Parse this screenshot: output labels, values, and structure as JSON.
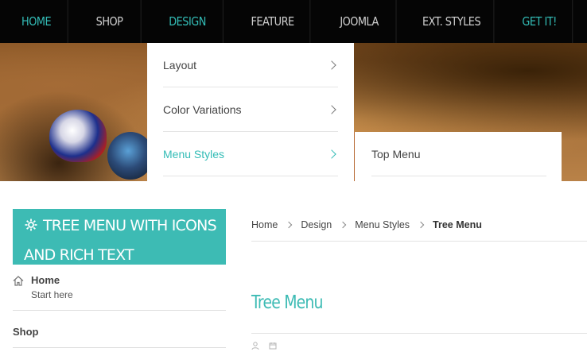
{
  "topnav": {
    "items": [
      {
        "label": "HOME"
      },
      {
        "label": "SHOP"
      },
      {
        "label": "DESIGN"
      },
      {
        "label": "FEATURE"
      },
      {
        "label": "JOOMLA"
      },
      {
        "label": "EXT. STYLES"
      },
      {
        "label": "GET IT!"
      }
    ]
  },
  "dropdown": {
    "items": [
      {
        "label": "Layout"
      },
      {
        "label": "Color Variations"
      },
      {
        "label": "Menu Styles"
      }
    ],
    "submenu": {
      "items": [
        {
          "label": "Top Menu"
        }
      ]
    }
  },
  "sidebar": {
    "module_title": "TREE MENU WITH ICONS AND RICH TEXT",
    "items": [
      {
        "label": "Home",
        "sublabel": "Start here",
        "icon": "home-icon"
      },
      {
        "label": "Shop"
      }
    ]
  },
  "breadcrumb": {
    "items": [
      "Home",
      "Design",
      "Menu Styles"
    ],
    "current": "Tree Menu"
  },
  "article": {
    "title": "Tree Menu"
  },
  "colors": {
    "accent": "#3dbbb4",
    "nav_background": "#050505",
    "text": "#444444"
  }
}
